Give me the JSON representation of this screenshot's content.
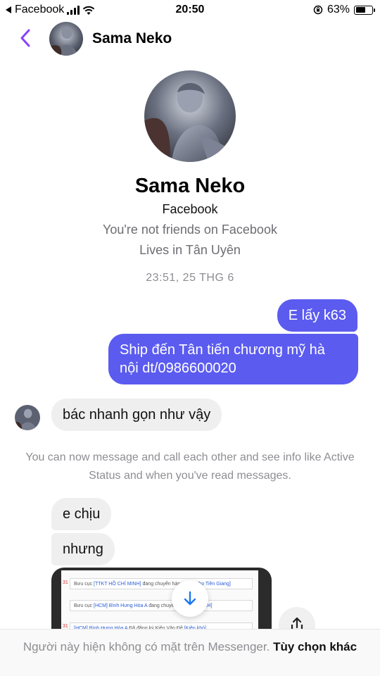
{
  "status_bar": {
    "back_app": "Facebook",
    "time": "20:50",
    "battery_percent": "63%",
    "battery_level": 0.63
  },
  "header": {
    "name": "Sama Neko"
  },
  "profile": {
    "name": "Sama Neko",
    "source": "Facebook",
    "friend_status": "You're not friends on Facebook",
    "lives_in": "Lives in Tân Uyên"
  },
  "timestamp": "23:51, 25 THG 6",
  "messages": [
    {
      "direction": "outgoing",
      "text": "E lấy k63"
    },
    {
      "direction": "outgoing",
      "text": "Ship đến Tân tiến chương mỹ hà nội dt/0986600020"
    },
    {
      "direction": "incoming",
      "text": "bác nhanh gọn như vậy"
    },
    {
      "direction": "incoming",
      "text": "e chịu"
    },
    {
      "direction": "incoming",
      "text": "nhưng"
    }
  ],
  "notice": "You can now message and call each other and see info like Active Status and when you've read messages.",
  "attachment": {
    "rows": [
      {
        "num": "31",
        "text_before": "Bưu cục ",
        "link1": "[TTKT HỒ CHÍ MINH]",
        "text_mid": " đang chuyển hàng đến ",
        "link2": "[Kho Tiền Giang]"
      },
      {
        "num": "",
        "text_before": "Bưu cục ",
        "link1": "[HCM] Bình Hưng Hòa A",
        "text_mid": " đang chuyể... ",
        "link2": "HỒ CHÍ MINH]"
      },
      {
        "num": "31",
        "text_before": "",
        "link1": "[HCM] Bình Hưng Hòa A",
        "text_mid": " Đã đăng ký Kiện Văn Đề ",
        "link2": "[Kiện khó]"
      }
    ]
  },
  "footer": {
    "message": "Người này hiện không có mặt trên Messenger.",
    "options": "Tùy chọn khác"
  },
  "colors": {
    "accent": "#8a3ffc",
    "outgoing_bubble": "#5b5bf0",
    "incoming_bubble": "#efefef",
    "scroll_arrow": "#1877f2"
  },
  "icons": {
    "back": "chevron-left-icon",
    "scroll": "arrow-down-icon",
    "share": "share-icon",
    "wifi": "wifi-icon",
    "signal": "signal-bars-icon",
    "battery": "battery-icon",
    "orientation_lock": "orientation-lock-icon"
  }
}
